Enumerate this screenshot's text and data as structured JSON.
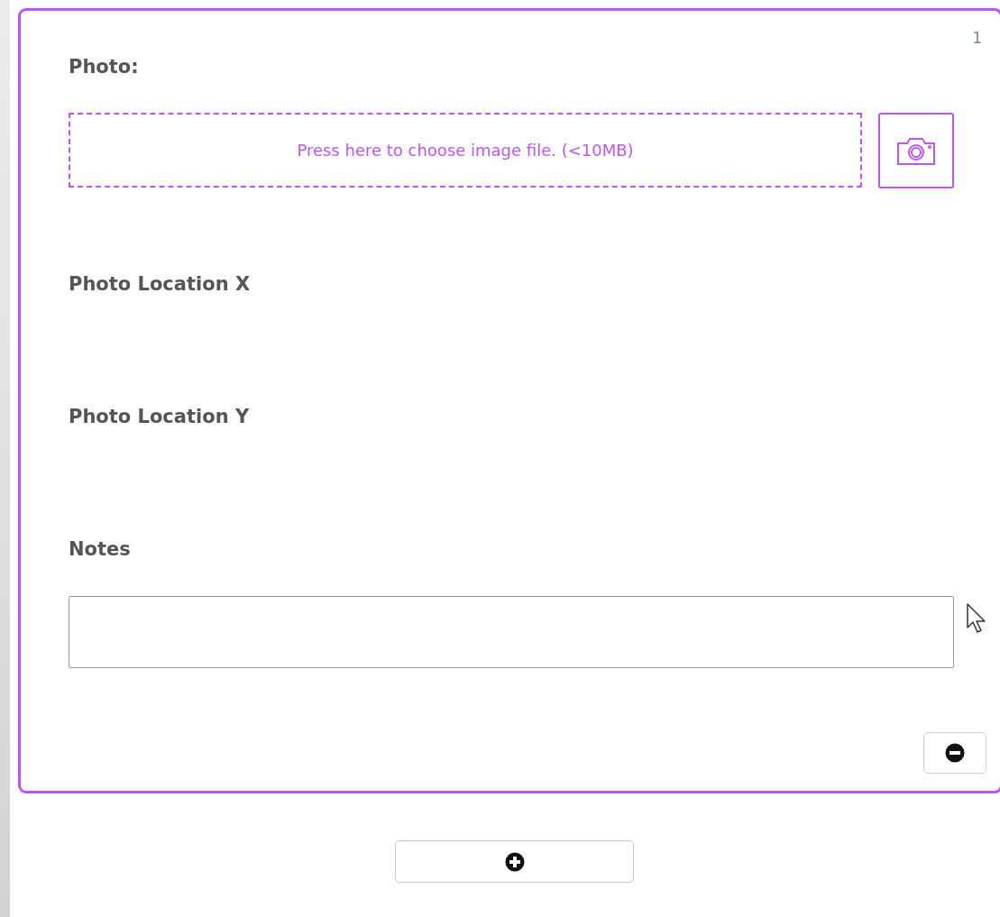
{
  "record": {
    "index": "1",
    "fields": [
      {
        "kind": "photo",
        "label": "Photo:",
        "placeholder": "Press here to choose image file. (<10MB)"
      },
      {
        "kind": "text",
        "label": "Photo Location X"
      },
      {
        "kind": "text",
        "label": "Photo Location Y"
      },
      {
        "kind": "textarea",
        "label": "Notes"
      }
    ]
  }
}
